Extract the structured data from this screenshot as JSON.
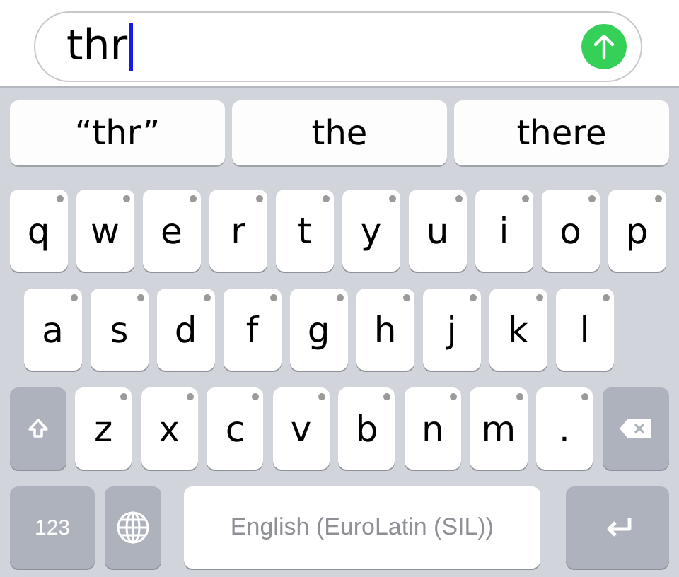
{
  "message_field": {
    "value": "thr"
  },
  "suggestions": [
    {
      "label": "“thr”"
    },
    {
      "label": "the"
    },
    {
      "label": "there"
    }
  ],
  "keyboard": {
    "top_row": [
      {
        "kind": "letter",
        "label": "q"
      },
      {
        "kind": "letter",
        "label": "w"
      },
      {
        "kind": "letter",
        "label": "e"
      },
      {
        "kind": "letter",
        "label": "r"
      },
      {
        "kind": "letter",
        "label": "t"
      },
      {
        "kind": "letter",
        "label": "y"
      },
      {
        "kind": "letter",
        "label": "u"
      },
      {
        "kind": "letter",
        "label": "i"
      },
      {
        "kind": "letter",
        "label": "o"
      },
      {
        "kind": "letter",
        "label": "p"
      }
    ],
    "home_row": [
      {
        "kind": "letter",
        "label": "a"
      },
      {
        "kind": "letter",
        "label": "s"
      },
      {
        "kind": "letter",
        "label": "d"
      },
      {
        "kind": "letter",
        "label": "f"
      },
      {
        "kind": "letter",
        "label": "g"
      },
      {
        "kind": "letter",
        "label": "h"
      },
      {
        "kind": "letter",
        "label": "j"
      },
      {
        "kind": "letter",
        "label": "k"
      },
      {
        "kind": "letter",
        "label": "l"
      }
    ],
    "lower_row": [
      {
        "kind": "shift"
      },
      {
        "kind": "letter",
        "label": "z"
      },
      {
        "kind": "letter",
        "label": "x"
      },
      {
        "kind": "letter",
        "label": "c"
      },
      {
        "kind": "letter",
        "label": "v"
      },
      {
        "kind": "letter",
        "label": "b"
      },
      {
        "kind": "letter",
        "label": "n"
      },
      {
        "kind": "letter",
        "label": "m"
      },
      {
        "kind": "letter",
        "label": "."
      },
      {
        "kind": "backspace"
      }
    ],
    "bottom_bar": [
      {
        "kind": "numbers",
        "label": "123"
      },
      {
        "kind": "globe"
      },
      {
        "kind": "space",
        "label": "English (EuroLatin (SIL))"
      },
      {
        "kind": "return"
      }
    ]
  }
}
